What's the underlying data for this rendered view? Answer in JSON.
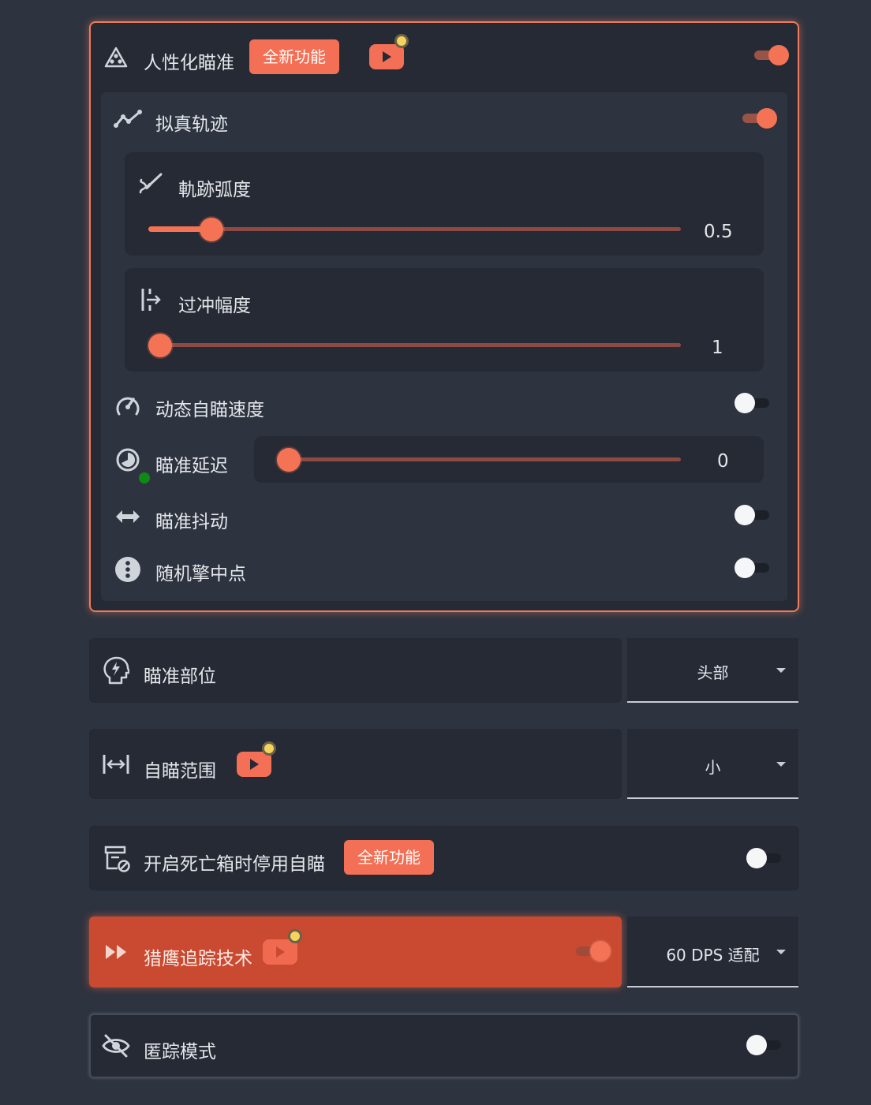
{
  "humanize": {
    "label": "人性化瞄准",
    "badge": "全新功能",
    "enabled": true,
    "trajectory": {
      "label": "拟真轨迹",
      "enabled": true,
      "curve": {
        "label": "軌跡弧度",
        "value": "0.5",
        "fraction": 0.1
      },
      "overshoot": {
        "label": "过冲幅度",
        "value": "1",
        "fraction": 0.0
      }
    },
    "dynamic_speed": {
      "label": "动态自瞄速度",
      "enabled": false
    },
    "aim_delay": {
      "label": "瞄准延迟",
      "value": "0",
      "fraction": 0.0
    },
    "aim_shake": {
      "label": "瞄准抖动",
      "enabled": false
    },
    "random_hit": {
      "label": "随机擎中点",
      "enabled": false
    }
  },
  "aim_part": {
    "label": "瞄准部位",
    "selected": "头部"
  },
  "aim_range": {
    "label": "自瞄范围",
    "selected": "小"
  },
  "deathbox": {
    "label": "开启死亡箱时停用自瞄",
    "badge": "全新功能",
    "enabled": false
  },
  "hunter": {
    "label": "猎鹰追踪技术",
    "enabled": true,
    "selected": "60 DPS 适配"
  },
  "stealth": {
    "label": "匿踪模式",
    "enabled": false
  },
  "colors": {
    "accent": "#f57355",
    "background": "#2d333f",
    "panel": "#252a35",
    "hunter_bg": "#c94a30"
  },
  "icons": [
    "triangle-dots-icon",
    "youtube-icon",
    "trajectory-line-icon",
    "brush-curve-icon",
    "overshoot-icon",
    "speedometer-icon",
    "timer-icon",
    "swap-horizontal-icon",
    "info-dots-icon",
    "head-lightning-icon",
    "width-arrows-icon",
    "box-off-icon",
    "fast-forward-icon",
    "eye-off-icon"
  ]
}
